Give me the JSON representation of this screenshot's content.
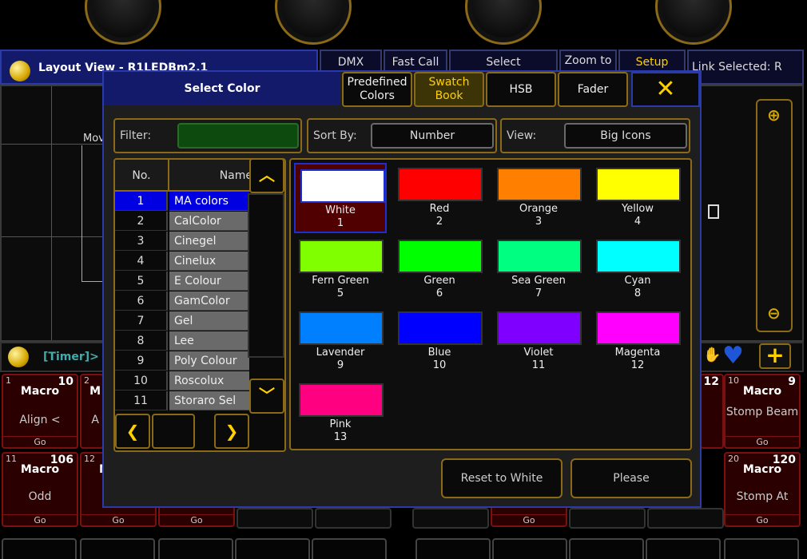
{
  "background": {
    "layout_view_title": "Layout View - R1LEDBm2.1",
    "top_tabs": [
      "DMX",
      "Fast Call",
      "Select",
      "Zoom to",
      "Setup",
      "Link Selected: R"
    ],
    "timer_label": "[Timer]>",
    "partial_label": "Mov",
    "executors_top": [
      {
        "num": "1",
        "count": "10",
        "type": "Macro",
        "name": "Align <",
        "go": "Go"
      },
      {
        "num": "2",
        "count": "",
        "type": "M",
        "name": "A",
        "go": ""
      },
      {
        "num": "",
        "count": "12",
        "type": "",
        "name": "",
        "go": ""
      },
      {
        "num": "10",
        "count": "9",
        "type": "Macro",
        "name": "Stomp Beam",
        "go": "Go"
      }
    ],
    "executors_bottom": [
      {
        "num": "11",
        "count": "106",
        "type": "Macro",
        "name": "Odd",
        "go": "Go"
      },
      {
        "num": "12",
        "count": "",
        "type": "M",
        "name": "",
        "go": "Go"
      },
      {
        "num": "",
        "count": "",
        "type": "",
        "name": "",
        "go": "Go"
      },
      {
        "num": "",
        "count": "",
        "type": "",
        "name": "",
        "go": "Go"
      },
      {
        "num": "20",
        "count": "120",
        "type": "Macro",
        "name": "Stomp At",
        "go": "Go"
      }
    ]
  },
  "dialog": {
    "title": "Select Color",
    "modes": [
      "Predefined Colors",
      "Swatch Book",
      "HSB",
      "Fader"
    ],
    "active_mode": "Swatch Book",
    "close_icon": "close-x-icon",
    "filter_label": "Filter:",
    "filter_value": "",
    "sort_label": "Sort By:",
    "sort_value": "Number",
    "view_label": "View:",
    "view_value": "Big Icons",
    "pool_headers": {
      "no": "No.",
      "name": "Name"
    },
    "pools": [
      {
        "no": "1",
        "name": "MA colors",
        "selected": true
      },
      {
        "no": "2",
        "name": "CalColor"
      },
      {
        "no": "3",
        "name": "Cinegel"
      },
      {
        "no": "4",
        "name": "Cinelux"
      },
      {
        "no": "5",
        "name": "E Colour"
      },
      {
        "no": "6",
        "name": "GamColor"
      },
      {
        "no": "7",
        "name": "Gel"
      },
      {
        "no": "8",
        "name": "Lee"
      },
      {
        "no": "9",
        "name": "Poly Colour"
      },
      {
        "no": "10",
        "name": "Roscolux"
      },
      {
        "no": "11",
        "name": "Storaro Sel"
      }
    ],
    "swatches": [
      {
        "name": "White",
        "num": "1",
        "color": "#ffffff",
        "selected": true
      },
      {
        "name": "Red",
        "num": "2",
        "color": "#ff0000"
      },
      {
        "name": "Orange",
        "num": "3",
        "color": "#ff7f00"
      },
      {
        "name": "Yellow",
        "num": "4",
        "color": "#ffff00"
      },
      {
        "name": "Fern Green",
        "num": "5",
        "color": "#80ff00"
      },
      {
        "name": "Green",
        "num": "6",
        "color": "#00ff00"
      },
      {
        "name": "Sea Green",
        "num": "7",
        "color": "#00ff80"
      },
      {
        "name": "Cyan",
        "num": "8",
        "color": "#00ffff"
      },
      {
        "name": "Lavender",
        "num": "9",
        "color": "#0080ff"
      },
      {
        "name": "Blue",
        "num": "10",
        "color": "#0000ff"
      },
      {
        "name": "Violet",
        "num": "11",
        "color": "#8000ff"
      },
      {
        "name": "Magenta",
        "num": "12",
        "color": "#ff00ff"
      },
      {
        "name": "Pink",
        "num": "13",
        "color": "#ff0080"
      }
    ],
    "reset_label": "Reset to White",
    "please_label": "Please"
  }
}
